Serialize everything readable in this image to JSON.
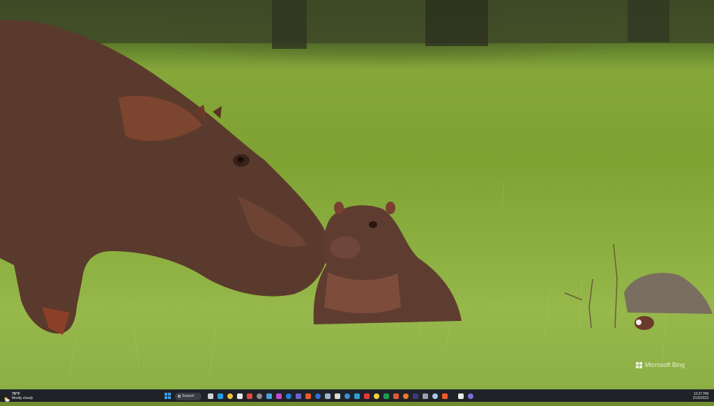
{
  "desktop": {
    "wallpaper_description_icon": "hippo-wallpaper",
    "watermark": "Microsoft Bing"
  },
  "taskbar": {
    "weather": {
      "temperature": "76°F",
      "condition": "Mostly cloudy",
      "icon": "partly-cloudy-icon"
    },
    "search_label": "Search",
    "pinned": [
      {
        "name": "start-button",
        "icon": "windows-logo-icon",
        "color": "#3aa0f0"
      },
      {
        "name": "task-view-button",
        "icon": "task-view-icon",
        "color": "#cfd3d8"
      },
      {
        "name": "edge-app",
        "icon": "edge-icon",
        "color": "#2a9be0"
      },
      {
        "name": "file-explorer-app",
        "icon": "folder-icon",
        "color": "#f3c13a"
      },
      {
        "name": "store-app",
        "icon": "store-icon",
        "color": "#e8e8e8"
      },
      {
        "name": "chrome-app",
        "icon": "chrome-icon",
        "color": "#e04a3a"
      },
      {
        "name": "calculator-app",
        "icon": "calculator-icon",
        "color": "#8a8f96"
      },
      {
        "name": "photos-app",
        "icon": "photos-icon",
        "color": "#4aa3df"
      },
      {
        "name": "snipping-app",
        "icon": "snip-icon",
        "color": "#c04bd0"
      },
      {
        "name": "outlook-app",
        "icon": "outlook-icon",
        "color": "#1c7fd6"
      },
      {
        "name": "teams-app",
        "icon": "teams-icon",
        "color": "#6b5fd3"
      },
      {
        "name": "office-app",
        "icon": "office-icon",
        "color": "#e85a2a"
      },
      {
        "name": "word-app",
        "icon": "word-icon",
        "color": "#2b6fd6"
      },
      {
        "name": "vpn-app",
        "icon": "key-icon",
        "color": "#9ab3cf"
      },
      {
        "name": "headset-app",
        "icon": "headset-icon",
        "color": "#d9d9d9"
      },
      {
        "name": "terminal-app",
        "icon": "terminal-icon",
        "color": "#3b8fd8"
      },
      {
        "name": "notes-app",
        "icon": "notes-icon",
        "color": "#2f9fd8"
      },
      {
        "name": "opera-app",
        "icon": "opera-icon",
        "color": "#e23a3a"
      },
      {
        "name": "sticky-app",
        "icon": "sticky-icon",
        "color": "#f2d33a"
      },
      {
        "name": "excel-app",
        "icon": "excel-icon",
        "color": "#1e9a4f"
      },
      {
        "name": "html-app",
        "icon": "html-icon",
        "color": "#e2553a"
      },
      {
        "name": "fire-app",
        "icon": "fire-icon",
        "color": "#f07a2a"
      },
      {
        "name": "adobe-app",
        "icon": "adobe-icon",
        "color": "#3a3a7a"
      },
      {
        "name": "monitor-app",
        "icon": "monitor-icon",
        "color": "#9aa0a8"
      },
      {
        "name": "document-app",
        "icon": "document-icon",
        "color": "#a9c8e8"
      },
      {
        "name": "brave-app",
        "icon": "brave-icon",
        "color": "#f05a2a"
      },
      {
        "name": "shield-app",
        "icon": "shield-icon",
        "color": "#e8e8e8"
      },
      {
        "name": "teams-chat-app",
        "icon": "chat-icon",
        "color": "#7b6fe0"
      }
    ],
    "clock": {
      "time": "12:37 PM",
      "date": "2/15/2023"
    }
  }
}
